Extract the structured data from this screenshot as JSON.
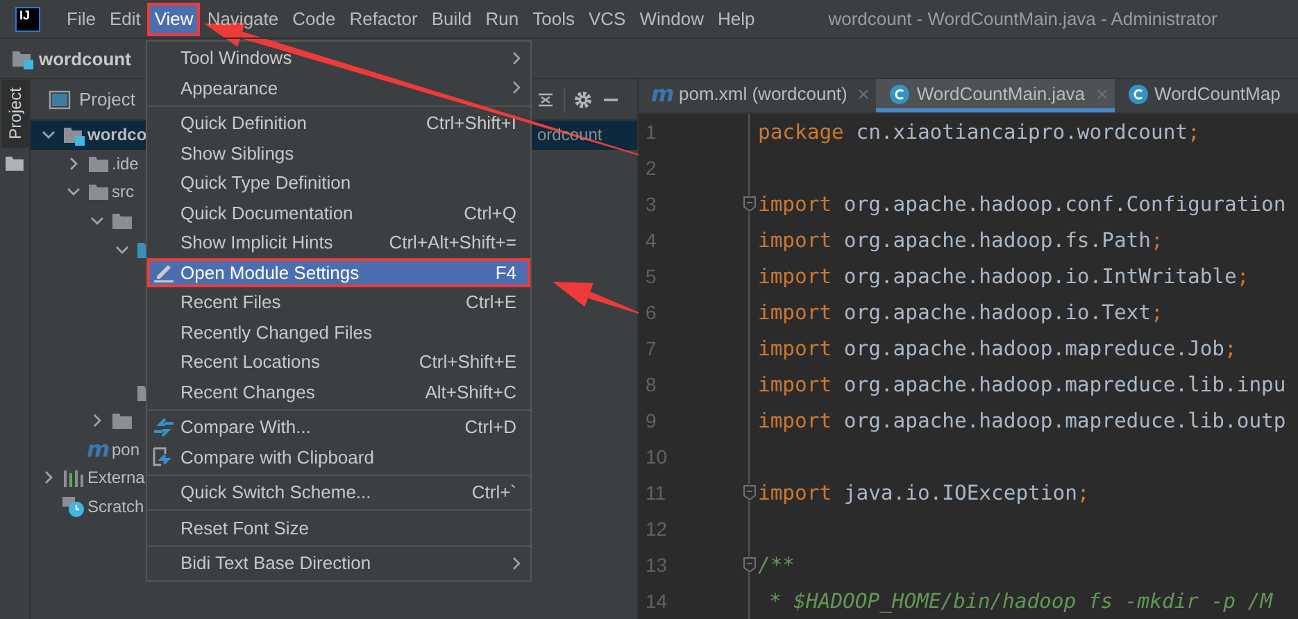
{
  "window": {
    "title": "wordcount - WordCountMain.java - Administrator",
    "logo": "IJ"
  },
  "menu_bar": [
    {
      "label": "File",
      "selected": false,
      "boxed": false
    },
    {
      "label": "Edit",
      "selected": false,
      "boxed": false
    },
    {
      "label": "View",
      "selected": true,
      "boxed": true
    },
    {
      "label": "Navigate",
      "selected": false,
      "boxed": false
    },
    {
      "label": "Code",
      "selected": false,
      "boxed": false
    },
    {
      "label": "Refactor",
      "selected": false,
      "boxed": false
    },
    {
      "label": "Build",
      "selected": false,
      "boxed": false
    },
    {
      "label": "Run",
      "selected": false,
      "boxed": false
    },
    {
      "label": "Tools",
      "selected": false,
      "boxed": false
    },
    {
      "label": "VCS",
      "selected": false,
      "boxed": false
    },
    {
      "label": "Window",
      "selected": false,
      "boxed": false
    },
    {
      "label": "Help",
      "selected": false,
      "boxed": false
    }
  ],
  "breadcrumb": "wordcount",
  "tool_stripe": [
    {
      "label": "Project",
      "selected": true
    }
  ],
  "project_panel": {
    "title": "Project",
    "tree": [
      {
        "label": "wordco",
        "path": "ordcount",
        "kind": "module",
        "expanded": true,
        "selected": true,
        "children": [
          {
            "label": ".ide",
            "kind": "folder",
            "expanded": false,
            "selected": false
          },
          {
            "label": "src",
            "kind": "folder",
            "expanded": true,
            "selected": false,
            "children": [
              {
                "kind": "folder",
                "expanded": true,
                "selected": false,
                "children": [
                  {
                    "kind": "package",
                    "expanded": true,
                    "selected": false,
                    "children": [
                      {
                        "selected": false
                      },
                      {
                        "selected": false
                      },
                      {
                        "selected": false
                      },
                      {
                        "selected": false
                      }
                    ]
                  },
                  {
                    "kind": "folder",
                    "selected": false
                  }
                ]
              },
              {
                "kind": "folder",
                "expanded": false,
                "selected": false
              }
            ]
          },
          {
            "label": "pon",
            "badge": "m",
            "kind": "maven",
            "selected": false
          }
        ]
      },
      {
        "label": "Externa",
        "kind": "library",
        "expanded": false,
        "selected": false
      },
      {
        "label": "Scratch",
        "kind": "scratches",
        "selected": false
      }
    ]
  },
  "view_menu": {
    "groups": [
      [
        {
          "label": "Tool Windows",
          "kind": "plain",
          "submenu": true,
          "selected": false,
          "boxed": false
        },
        {
          "label": "Appearance",
          "kind": "plain",
          "submenu": true,
          "selected": false,
          "boxed": false
        }
      ],
      [
        {
          "label": "Quick Definition",
          "kind": "plain",
          "shortcut": "Ctrl+Shift+I",
          "selected": false,
          "boxed": false
        },
        {
          "label": "Show Siblings",
          "kind": "plain",
          "selected": false,
          "boxed": false
        },
        {
          "label": "Quick Type Definition",
          "kind": "plain",
          "selected": false,
          "boxed": false
        },
        {
          "label": "Quick Documentation",
          "kind": "plain",
          "shortcut": "Ctrl+Q",
          "selected": false,
          "boxed": false
        },
        {
          "label": "Show Implicit Hints",
          "kind": "plain",
          "shortcut": "Ctrl+Alt+Shift+=",
          "selected": false,
          "boxed": false
        },
        {
          "label": "Open Module Settings",
          "kind": "edit",
          "shortcut": "F4",
          "selected": true,
          "boxed": true
        },
        {
          "label": "Recent Files",
          "kind": "plain",
          "shortcut": "Ctrl+E",
          "selected": false,
          "boxed": false
        },
        {
          "label": "Recently Changed Files",
          "kind": "plain",
          "selected": false,
          "boxed": false
        },
        {
          "label": "Recent Locations",
          "kind": "plain",
          "shortcut": "Ctrl+Shift+E",
          "selected": false,
          "boxed": false
        },
        {
          "label": "Recent Changes",
          "kind": "plain",
          "shortcut": "Alt+Shift+C",
          "selected": false,
          "boxed": false
        }
      ],
      [
        {
          "label": "Compare With...",
          "kind": "compare",
          "shortcut": "Ctrl+D",
          "selected": false,
          "boxed": false
        },
        {
          "label": "Compare with Clipboard",
          "kind": "clipboard",
          "selected": false,
          "boxed": false
        }
      ],
      [
        {
          "label": "Quick Switch Scheme...",
          "kind": "plain",
          "shortcut": "Ctrl+`",
          "selected": false,
          "boxed": false
        }
      ],
      [
        {
          "label": "Reset Font Size",
          "kind": "plain",
          "selected": false,
          "boxed": false
        }
      ],
      [
        {
          "label": "Bidi Text Base Direction",
          "kind": "plain",
          "submenu": true,
          "selected": false,
          "boxed": false
        }
      ]
    ]
  },
  "editor": {
    "tabs": [
      {
        "label": "pom.xml (wordcount)",
        "badge": "m",
        "kind": "maven",
        "selected": false,
        "closable": true
      },
      {
        "label": "WordCountMain.java",
        "kind": "class",
        "selected": true,
        "closable": true
      },
      {
        "label": "WordCountMap",
        "kind": "class",
        "selected": false,
        "closable": false
      }
    ],
    "lines": [
      {
        "number": "1",
        "fold": false,
        "tokens": [
          {
            "text": "package",
            "kind": "keyword"
          },
          {
            "text": " cn.xiaotiancaipro.wordcount",
            "kind": "plain"
          },
          {
            "text": ";",
            "kind": "keyword"
          }
        ]
      },
      {
        "number": "2",
        "fold": false
      },
      {
        "number": "3",
        "fold": true,
        "tokens": [
          {
            "text": "import",
            "kind": "keyword"
          },
          {
            "text": " org.apache.hadoop.conf.Configuration",
            "kind": "plain"
          }
        ]
      },
      {
        "number": "4",
        "fold": false,
        "tokens": [
          {
            "text": "import",
            "kind": "keyword"
          },
          {
            "text": " org.apache.hadoop.fs.Path",
            "kind": "plain"
          },
          {
            "text": ";",
            "kind": "keyword"
          }
        ]
      },
      {
        "number": "5",
        "fold": false,
        "tokens": [
          {
            "text": "import",
            "kind": "keyword"
          },
          {
            "text": " org.apache.hadoop.io.IntWritable",
            "kind": "plain"
          },
          {
            "text": ";",
            "kind": "keyword"
          }
        ]
      },
      {
        "number": "6",
        "fold": false,
        "tokens": [
          {
            "text": "import",
            "kind": "keyword"
          },
          {
            "text": " org.apache.hadoop.io.Text",
            "kind": "plain"
          },
          {
            "text": ";",
            "kind": "keyword"
          }
        ]
      },
      {
        "number": "7",
        "fold": false,
        "tokens": [
          {
            "text": "import",
            "kind": "keyword"
          },
          {
            "text": " org.apache.hadoop.mapreduce.Job",
            "kind": "plain"
          },
          {
            "text": ";",
            "kind": "keyword"
          }
        ]
      },
      {
        "number": "8",
        "fold": false,
        "tokens": [
          {
            "text": "import",
            "kind": "keyword"
          },
          {
            "text": " org.apache.hadoop.mapreduce.lib.inpu",
            "kind": "plain"
          }
        ]
      },
      {
        "number": "9",
        "fold": false,
        "tokens": [
          {
            "text": "import",
            "kind": "keyword"
          },
          {
            "text": " org.apache.hadoop.mapreduce.lib.outp",
            "kind": "plain"
          }
        ]
      },
      {
        "number": "10",
        "fold": false
      },
      {
        "number": "11",
        "fold": true,
        "tokens": [
          {
            "text": "import",
            "kind": "keyword"
          },
          {
            "text": " java.io.IOException",
            "kind": "plain"
          },
          {
            "text": ";",
            "kind": "keyword"
          }
        ]
      },
      {
        "number": "12",
        "fold": false
      },
      {
        "number": "13",
        "fold": true,
        "tokens": [
          {
            "text": "/**",
            "kind": "comment"
          }
        ]
      },
      {
        "number": "14",
        "fold": false,
        "tokens": [
          {
            "text": "* $HADOOP_HOME/bin/hadoop fs -mkdir -p /M",
            "kind": "comment"
          }
        ]
      }
    ]
  }
}
